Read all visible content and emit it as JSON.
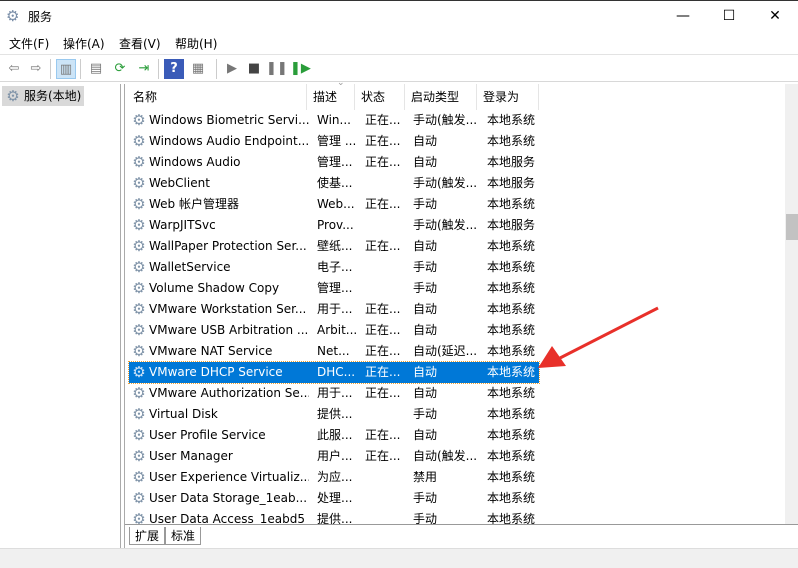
{
  "window": {
    "title": "服务",
    "minimize": "—",
    "maximize": "☐",
    "close": "✕"
  },
  "menu": [
    "文件(F)",
    "操作(A)",
    "查看(V)",
    "帮助(H)"
  ],
  "toolbar": [
    {
      "icon": "back-icon",
      "glyph": "⇦"
    },
    {
      "icon": "forward-icon",
      "glyph": "⇨"
    },
    {
      "icon": "show-hide-console-tree-icon",
      "glyph": "▥"
    },
    {
      "icon": "properties-icon",
      "glyph": "▤"
    },
    {
      "icon": "refresh-icon",
      "glyph": "⟳"
    },
    {
      "icon": "export-list-icon",
      "glyph": "⇥"
    },
    {
      "icon": "help-icon",
      "glyph": "?"
    },
    {
      "icon": "show-action-pane-icon",
      "glyph": "▦"
    },
    {
      "icon": "start-service-icon",
      "glyph": "▶"
    },
    {
      "icon": "stop-service-icon",
      "glyph": "■"
    },
    {
      "icon": "pause-service-icon",
      "glyph": "❚❚"
    },
    {
      "icon": "restart-service-icon",
      "glyph": "❚▶"
    }
  ],
  "tree": {
    "item": "服务(本地)"
  },
  "columns": [
    "名称",
    "描述",
    "状态",
    "启动类型",
    "登录为"
  ],
  "rows": [
    [
      "Windows Biometric Servi...",
      "Win...",
      "正在...",
      "手动(触发...",
      "本地系统"
    ],
    [
      "Windows Audio Endpoint...",
      "管理 ...",
      "正在...",
      "自动",
      "本地系统"
    ],
    [
      "Windows Audio",
      "管理...",
      "正在...",
      "自动",
      "本地服务"
    ],
    [
      "WebClient",
      "使基...",
      "",
      "手动(触发...",
      "本地服务"
    ],
    [
      "Web 帐户管理器",
      "Web...",
      "正在...",
      "手动",
      "本地系统"
    ],
    [
      "WarpJITSvc",
      "Prov...",
      "",
      "手动(触发...",
      "本地服务"
    ],
    [
      "WallPaper Protection Ser...",
      "壁纸...",
      "正在...",
      "自动",
      "本地系统"
    ],
    [
      "WalletService",
      "电子...",
      "",
      "手动",
      "本地系统"
    ],
    [
      "Volume Shadow Copy",
      "管理...",
      "",
      "手动",
      "本地系统"
    ],
    [
      "VMware Workstation Ser...",
      "用于...",
      "正在...",
      "自动",
      "本地系统"
    ],
    [
      "VMware USB Arbitration ...",
      "Arbit...",
      "正在...",
      "自动",
      "本地系统"
    ],
    [
      "VMware NAT Service",
      "Net...",
      "正在...",
      "自动(延迟...",
      "本地系统"
    ],
    [
      "VMware DHCP Service",
      "DHC...",
      "正在...",
      "自动",
      "本地系统"
    ],
    [
      "VMware Authorization Se...",
      "用于...",
      "正在...",
      "自动",
      "本地系统"
    ],
    [
      "Virtual Disk",
      "提供...",
      "",
      "手动",
      "本地系统"
    ],
    [
      "User Profile Service",
      "此服...",
      "正在...",
      "自动",
      "本地系统"
    ],
    [
      "User Manager",
      "用户...",
      "正在...",
      "自动(触发...",
      "本地系统"
    ],
    [
      "User Experience Virtualiz...",
      "为应...",
      "",
      "禁用",
      "本地系统"
    ],
    [
      "User Data Storage_1eab...",
      "处理...",
      "",
      "手动",
      "本地系统"
    ],
    [
      "User Data Access_1eabd5",
      "提供...",
      "",
      "手动",
      "本地系统"
    ]
  ],
  "selected_row": 12,
  "tabs": [
    "扩展",
    "标准"
  ],
  "colors": {
    "selection": "#0078d7",
    "annotation_arrow": "#e8302a"
  }
}
